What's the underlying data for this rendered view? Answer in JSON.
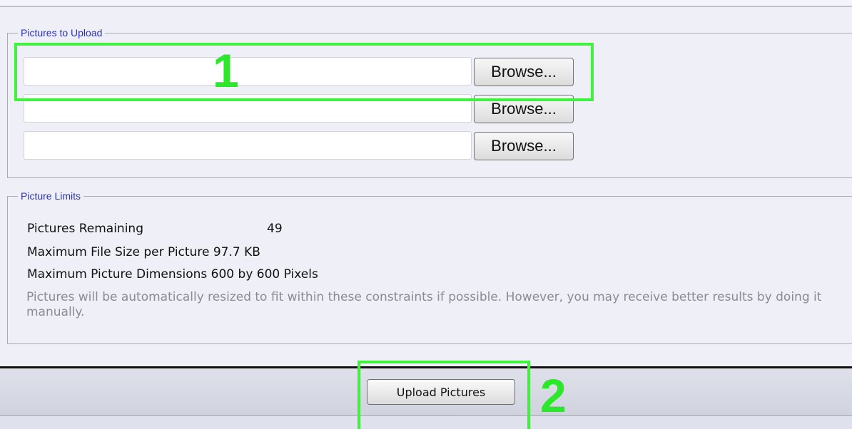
{
  "upload_section": {
    "legend": "Pictures to Upload",
    "rows": [
      {
        "value": "",
        "button_label": "Browse..."
      },
      {
        "value": "",
        "button_label": "Browse..."
      },
      {
        "value": "",
        "button_label": "Browse..."
      }
    ]
  },
  "limits_section": {
    "legend": "Picture Limits",
    "items": [
      {
        "label": "Pictures Remaining",
        "value": "49"
      },
      {
        "label": "Maximum File Size per Picture",
        "value": "97.7 KB"
      },
      {
        "label": "Maximum Picture Dimensions",
        "value": "600 by 600 Pixels"
      }
    ],
    "note": "Pictures will be automatically resized to fit within these constraints if possible. However, you may receive better results by doing it manually."
  },
  "footer": {
    "upload_button_label": "Upload Pictures"
  },
  "annotations": {
    "step_1": "1",
    "step_2": "2",
    "highlight_color": "#3ef23e"
  }
}
